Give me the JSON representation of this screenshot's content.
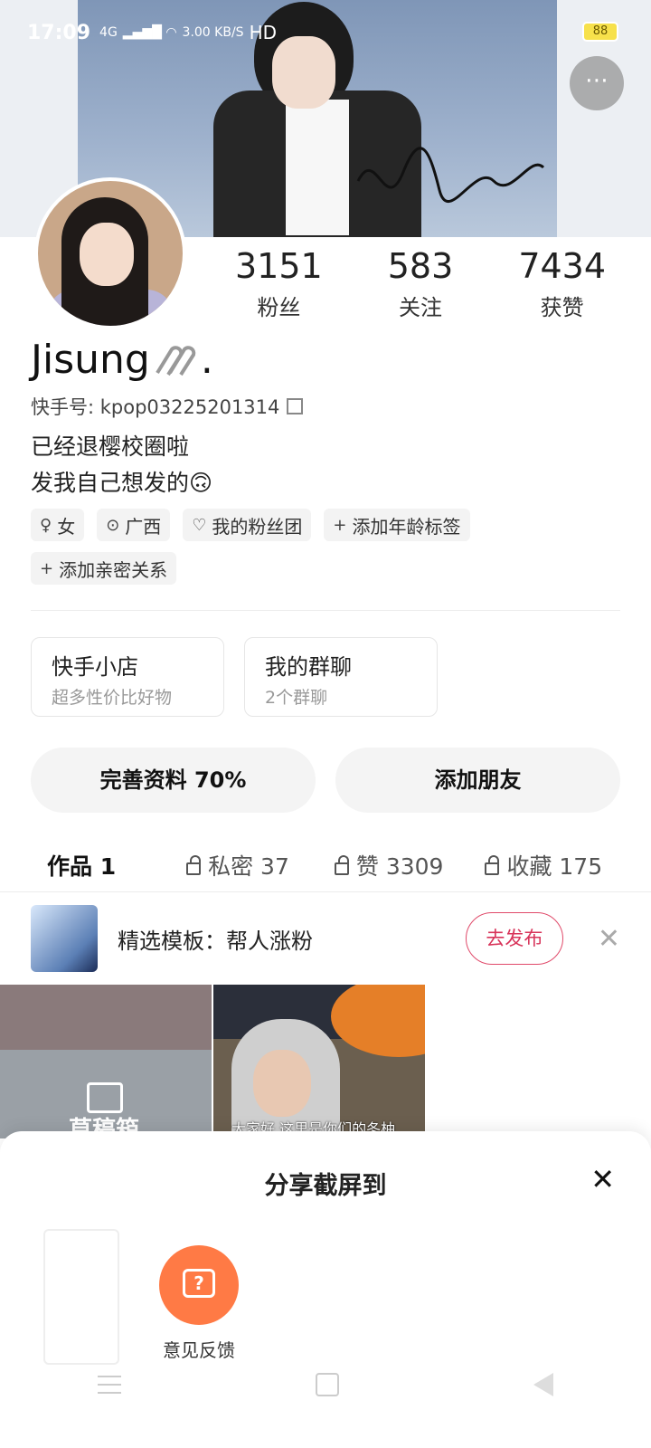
{
  "status_bar": {
    "time": "17:09",
    "network": "4G",
    "speed": "3.00 KB/S",
    "hd": "HD",
    "battery": "88"
  },
  "profile": {
    "name": "Jisung",
    "name_suffix": ".",
    "kuaishou_id": "快手号: kpop03225201314",
    "bio_line1": "已经退樱校圈啦",
    "bio_line2": "发我自己想发的🙃"
  },
  "stats": [
    {
      "num": "3151",
      "label": "粉丝"
    },
    {
      "num": "583",
      "label": "关注"
    },
    {
      "num": "7434",
      "label": "获赞"
    }
  ],
  "tags": [
    {
      "icon": "gender-female-icon",
      "label": "女"
    },
    {
      "icon": "location-icon",
      "label": "广西"
    },
    {
      "icon": "heart-icon",
      "label": "我的粉丝团"
    },
    {
      "icon": "plus-icon",
      "label": "添加年龄标签"
    },
    {
      "icon": "plus-icon",
      "label": "添加亲密关系"
    }
  ],
  "cards": [
    {
      "title": "快手小店",
      "subtitle": "超多性价比好物"
    },
    {
      "title": "我的群聊",
      "subtitle": "2个群聊"
    }
  ],
  "actions": {
    "complete_profile": "完善资料 70%",
    "add_friend": "添加朋友"
  },
  "tabs": [
    {
      "label": "作品 1",
      "locked": false
    },
    {
      "label": "私密 37",
      "locked": true
    },
    {
      "label": "赞 3309",
      "locked": true
    },
    {
      "label": "收藏 175",
      "locked": true
    }
  ],
  "promo": {
    "text": "精选模板：帮人涨粉",
    "button": "去发布"
  },
  "grid": {
    "draft_label": "草稿箱",
    "video_caption": "大家好 这里是你们的冬柚"
  },
  "share_sheet": {
    "title": "分享截屏到",
    "feedback_label": "意见反馈"
  },
  "colors": {
    "accent": "#d8345a",
    "feedback": "#ff7a45"
  }
}
